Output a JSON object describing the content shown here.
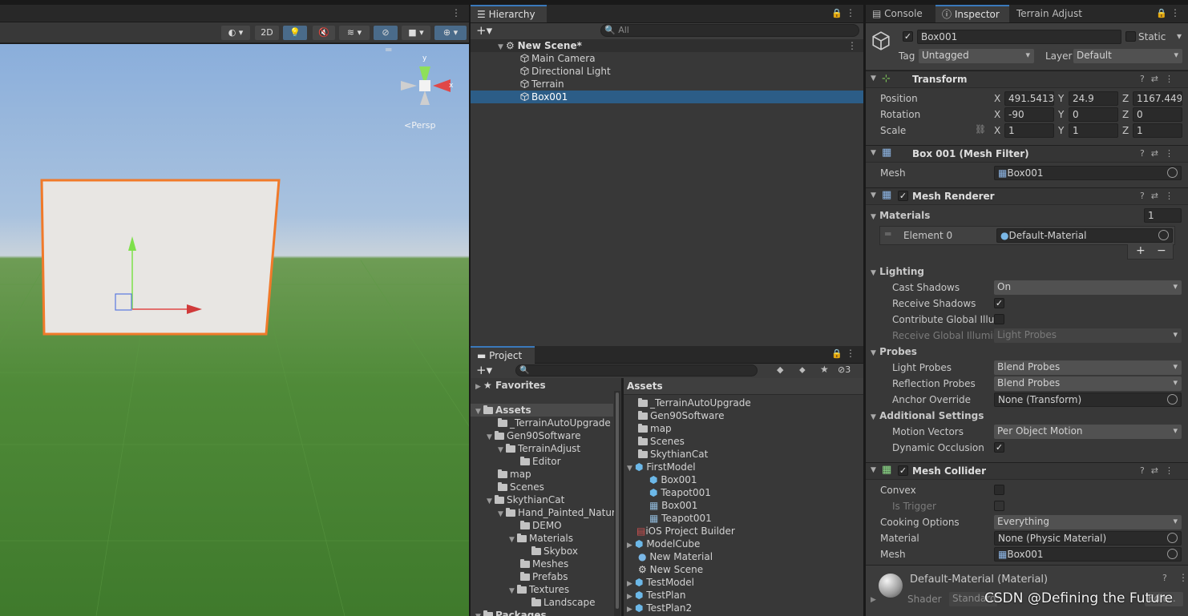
{
  "scene": {
    "toolbar_2d": "2D",
    "persp": "<Persp"
  },
  "hierarchy": {
    "tab": "Hierarchy",
    "search_placeholder": "All",
    "scene_name": "New Scene*",
    "items": [
      "Main Camera",
      "Directional Light",
      "Terrain",
      "Box001"
    ]
  },
  "project": {
    "tab": "Project",
    "hidden_count": "3",
    "favorites": "Favorites",
    "assets_root": "Assets",
    "packages": "Packages",
    "tree": [
      "_TerrainAutoUpgrade",
      "Gen90Software",
      "TerrainAdjust",
      "Editor",
      "map",
      "Scenes",
      "SkythianCat",
      "Hand_Painted_Natur",
      "DEMO",
      "Materials",
      "Skybox",
      "Meshes",
      "Prefabs",
      "Textures",
      "Landscape"
    ],
    "assets_header": "Assets",
    "assets_list": [
      "_TerrainAutoUpgrade",
      "Gen90Software",
      "map",
      "Scenes",
      "SkythianCat",
      "FirstModel",
      "Box001",
      "Teapot001",
      "Box001",
      "Teapot001",
      "iOS Project Builder",
      "ModelCube",
      "New Material",
      "New Scene",
      "TestModel",
      "TestPlan",
      "TestPlan2"
    ]
  },
  "tabs_right": {
    "console": "Console",
    "inspector": "Inspector",
    "terrain": "Terrain Adjust"
  },
  "inspector": {
    "object_name": "Box001",
    "static_label": "Static",
    "tag_label": "Tag",
    "tag_value": "Untagged",
    "layer_label": "Layer",
    "layer_value": "Default",
    "transform": {
      "title": "Transform",
      "position_label": "Position",
      "rotation_label": "Rotation",
      "scale_label": "Scale",
      "axis_x": "X",
      "axis_y": "Y",
      "axis_z": "Z",
      "position": {
        "x": "491.5413",
        "y": "24.9",
        "z": "1167.449"
      },
      "rotation": {
        "x": "-90",
        "y": "0",
        "z": "0"
      },
      "scale": {
        "x": "1",
        "y": "1",
        "z": "1"
      }
    },
    "mesh_filter": {
      "title": "Box 001 (Mesh Filter)",
      "mesh_label": "Mesh",
      "mesh_value": "Box001"
    },
    "mesh_renderer": {
      "title": "Mesh Renderer",
      "materials_label": "Materials",
      "materials_count": "1",
      "element_label": "Element 0",
      "element_value": "Default-Material",
      "plus": "+",
      "minus": "−",
      "lighting": "Lighting",
      "cast_shadows_label": "Cast Shadows",
      "cast_shadows_value": "On",
      "receive_shadows_label": "Receive Shadows",
      "contribute_gi_label": "Contribute Global Illum",
      "receive_gi_label": "Receive Global Illumin",
      "receive_gi_value": "Light Probes",
      "probes": "Probes",
      "light_probes_label": "Light Probes",
      "light_probes_value": "Blend Probes",
      "reflection_probes_label": "Reflection Probes",
      "reflection_probes_value": "Blend Probes",
      "anchor_override_label": "Anchor Override",
      "anchor_override_value": "None (Transform)",
      "additional": "Additional Settings",
      "motion_vectors_label": "Motion Vectors",
      "motion_vectors_value": "Per Object Motion",
      "dynamic_occlusion_label": "Dynamic Occlusion"
    },
    "mesh_collider": {
      "title": "Mesh Collider",
      "convex_label": "Convex",
      "is_trigger_label": "Is Trigger",
      "cooking_label": "Cooking Options",
      "cooking_value": "Everything",
      "material_label": "Material",
      "material_value": "None (Physic Material)",
      "mesh_label": "Mesh",
      "mesh_value": "Box001"
    },
    "material_footer": {
      "name": "Default-Material (Material)",
      "shader_label": "Shader",
      "shader_value": "Standard",
      "edit": "Edit..."
    }
  },
  "watermark": "CSDN @Defining the Future",
  "colors": {
    "accent": "#3a79bb",
    "selection": "#2c5d87",
    "outline": "#f07a2a",
    "sky": "#8fb0d8",
    "ground": "#4f8a38"
  }
}
